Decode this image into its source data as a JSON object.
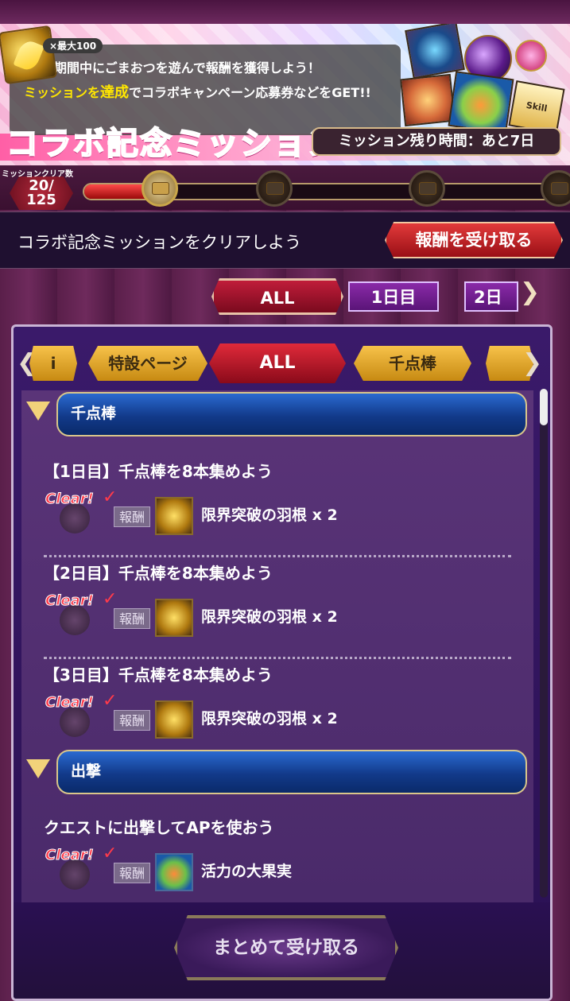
{
  "banner": {
    "max_label": "×最大100",
    "line1": "期間中にごまおつを遊んで報酬を獲得しよう！",
    "line2_prefix": "ミッションを",
    "line2_highlight": "達成",
    "line2_suffix": "でコラボキャンペーン応募券などをGET!!",
    "title": "コラボ記念ミッション",
    "timer": "ミッション残り時間：あと7日",
    "art_label": "Skill"
  },
  "progress": {
    "label": "ミッションクリア数",
    "count": "20/",
    "total": "125",
    "fill_fraction": 0.16
  },
  "claim": {
    "text": "コラボ記念ミッションをクリアしよう",
    "button": "報酬を受け取る"
  },
  "day_tabs": {
    "all": "ALL",
    "day1": "1日目",
    "day2": "2日"
  },
  "category_tabs": {
    "special": "特設ページ",
    "all": "ALL",
    "senten": "千点棒",
    "prev_fragment": "i"
  },
  "sections": [
    {
      "title": "千点棒",
      "missions": [
        {
          "title": "【1日目】千点棒を8本集めよう",
          "stamp": "Clear!",
          "reward_label": "報酬",
          "reward": "限界突破の羽根 x 2"
        },
        {
          "title": "【2日目】千点棒を8本集めよう",
          "stamp": "Clear!",
          "reward_label": "報酬",
          "reward": "限界突破の羽根 x 2"
        },
        {
          "title": "【3日目】千点棒を8本集めよう",
          "stamp": "Clear!",
          "reward_label": "報酬",
          "reward": "限界突破の羽根 x 2"
        }
      ]
    },
    {
      "title": "出撃",
      "missions": [
        {
          "title": "クエストに出撃してAPを使おう",
          "stamp": "Clear!",
          "reward_label": "報酬",
          "reward": "活力の大果実"
        }
      ]
    }
  ],
  "bulk_button": "まとめて受け取る"
}
